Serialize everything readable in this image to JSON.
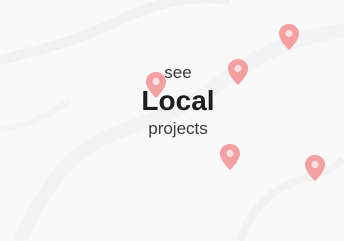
{
  "card": {
    "line1": "see",
    "line2": "Local",
    "line3": "projects"
  },
  "map": {
    "pin_icon": "map-pin-icon",
    "pin_color": "#f4a0a0",
    "background_color": "#f9f9f9",
    "road_color": "#f1f1f1"
  }
}
